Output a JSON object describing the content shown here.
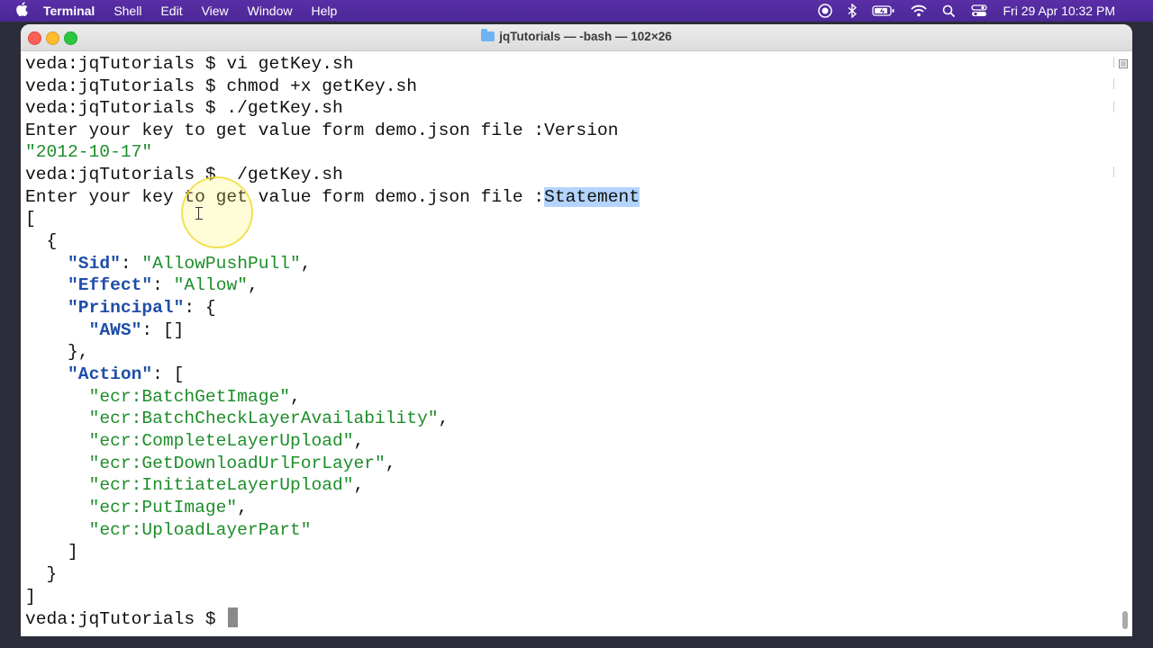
{
  "menubar": {
    "app": "Terminal",
    "items": [
      "Shell",
      "Edit",
      "View",
      "Window",
      "Help"
    ],
    "clock": "Fri 29 Apr  10:32 PM"
  },
  "window": {
    "title": "jqTutorials — -bash — 102×26"
  },
  "terminal": {
    "prompt": "veda:jqTutorials $ ",
    "cmd1": "vi getKey.sh",
    "cmd2": "chmod +x getKey.sh",
    "cmd3": "./getKey.sh",
    "ask": "Enter your key to get value form demo.json file :",
    "answer1": "Version",
    "result1": "\"2012-10-17\"",
    "cmd4": " /getKey.sh",
    "answer2": "Statement",
    "json": {
      "open_array": "[",
      "open_obj": "{",
      "k_sid": "\"Sid\"",
      "v_sid": "\"AllowPushPull\"",
      "k_effect": "\"Effect\"",
      "v_effect": "\"Allow\"",
      "k_principal": "\"Principal\"",
      "open_principal": ": {",
      "k_aws": "\"AWS\"",
      "v_aws": ": []",
      "close_principal": "},",
      "k_action": "\"Action\"",
      "open_action": ": [",
      "actions": [
        "\"ecr:BatchGetImage\"",
        "\"ecr:BatchCheckLayerAvailability\"",
        "\"ecr:CompleteLayerUpload\"",
        "\"ecr:GetDownloadUrlForLayer\"",
        "\"ecr:InitiateLayerUpload\"",
        "\"ecr:PutImage\"",
        "\"ecr:UploadLayerPart\""
      ],
      "close_action": "]",
      "close_obj": "}",
      "close_array": "]"
    }
  }
}
